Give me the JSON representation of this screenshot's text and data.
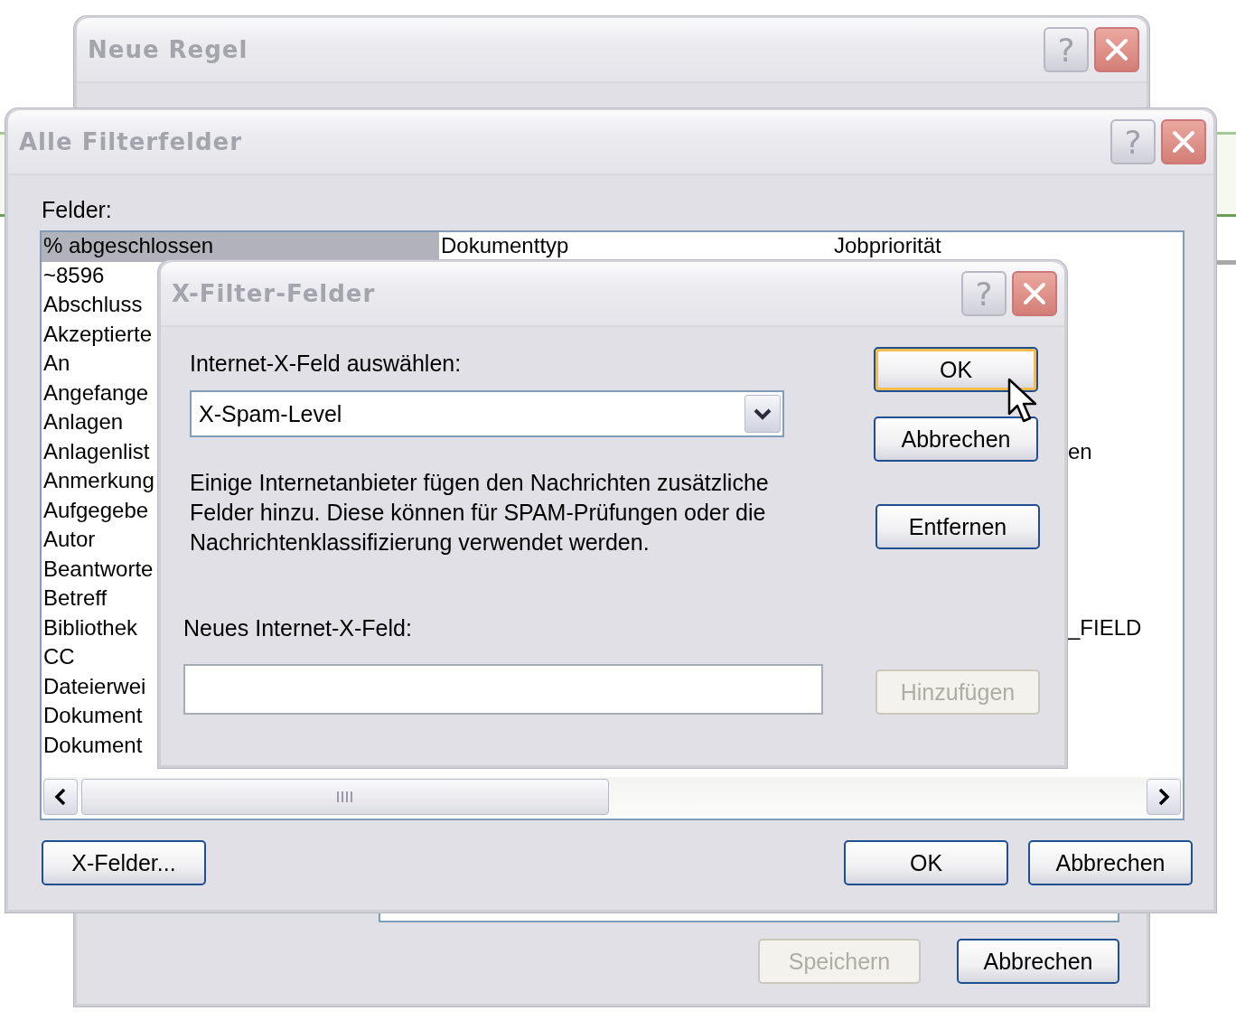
{
  "neue_regel": {
    "title": "Neue Regel",
    "help_glyph": "?",
    "buttons": [
      {
        "label": "Speichern",
        "disabled": true
      },
      {
        "label": "Abbrechen",
        "disabled": false
      }
    ]
  },
  "alle_filterfelder": {
    "title": "Alle Filterfelder",
    "help_glyph": "?",
    "list_label": "Felder:",
    "rows": [
      {
        "column_1": "% abgeschlossen",
        "column_2": "Dokumenttyp",
        "column_3": "Jobpriorität",
        "selected": true
      },
      {
        "column_1": "~8596",
        "selected": false
      },
      {
        "column_1": "Abschluss",
        "selected": false
      },
      {
        "column_1": "Akzeptierte",
        "selected": false
      },
      {
        "column_1": "An",
        "selected": false
      },
      {
        "column_1": "Angefange",
        "selected": false
      },
      {
        "column_1": "Anlagen",
        "selected": false
      },
      {
        "column_1": "Anlagenlist",
        "column_3": "en",
        "column_3_start_hidden": true,
        "selected": false
      },
      {
        "column_1": "Anmerkung",
        "selected": false
      },
      {
        "column_1": "Aufgegebe",
        "selected": false
      },
      {
        "column_1": "Autor",
        "selected": false
      },
      {
        "column_1": "Beantworte",
        "selected": false
      },
      {
        "column_1": "Betreff",
        "selected": false
      },
      {
        "column_1": "Bibliothek",
        "column_3": "_FIELD",
        "column_3_start_hidden": true,
        "selected": false
      },
      {
        "column_1": "CC",
        "selected": false
      },
      {
        "column_1": "Dateierwei",
        "selected": false
      },
      {
        "column_1": "Dokument",
        "selected": false
      },
      {
        "column_1": "Dokument",
        "selected": false
      }
    ],
    "buttons": [
      {
        "label": "X-Felder...",
        "disabled": false
      },
      {
        "label": "OK",
        "disabled": false
      },
      {
        "label": "Abbrechen",
        "disabled": false
      }
    ]
  },
  "x_filter_felder": {
    "title": "X-Filter-Felder",
    "help_glyph": "?",
    "select_label": "Internet-X-Feld auswählen:",
    "select_value": "X-Spam-Level",
    "description": "Einige Internetanbieter fügen den Nachrichten zusätzliche\nFelder hinzu. Diese können für SPAM-Prüfungen oder die\nNachrichtenklassifizierung verwendet werden.",
    "new_label": "Neues Internet-X-Feld:",
    "buttons": [
      {
        "label": "OK",
        "disabled": false,
        "focused": true
      },
      {
        "label": "Abbrechen",
        "disabled": false,
        "focused": false
      },
      {
        "label": "Entfernen",
        "disabled": false,
        "focused": false
      },
      {
        "label": "Hinzufügen",
        "disabled": true,
        "focused": false
      }
    ]
  }
}
